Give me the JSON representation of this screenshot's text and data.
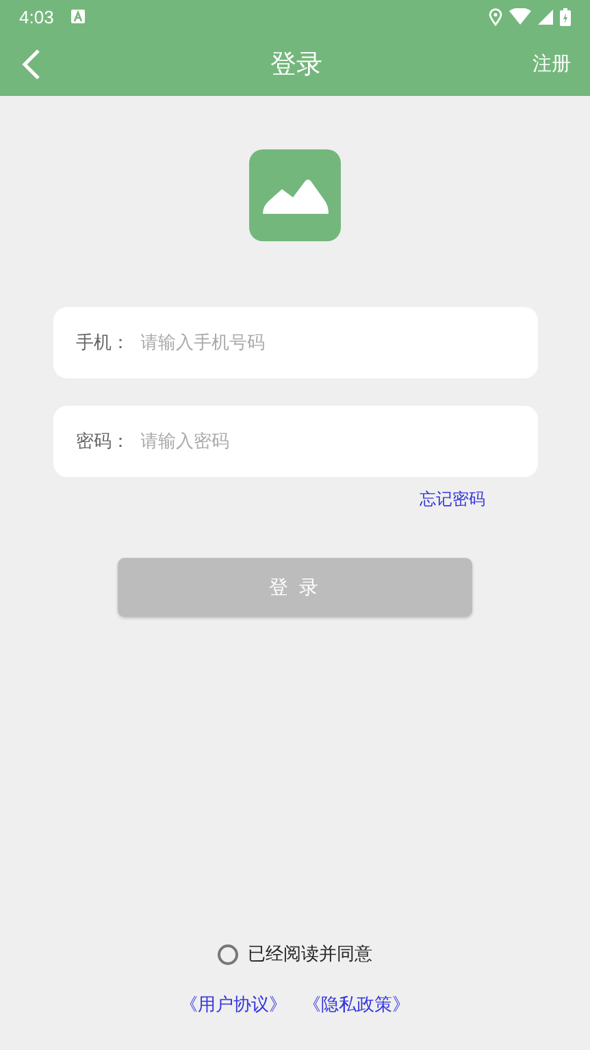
{
  "status_bar": {
    "time": "4:03"
  },
  "toolbar": {
    "title": "登录",
    "action": "注册"
  },
  "fields": [
    {
      "label": "手机：",
      "placeholder": "请输入手机号码"
    },
    {
      "label": "密码：",
      "placeholder": "请输入密码"
    }
  ],
  "forgot_link": "忘记密码",
  "login_button": {
    "label": "登 录",
    "disabled": true
  },
  "agreement": {
    "label": "已经阅读并同意",
    "checked": false
  },
  "links": [
    "《用户协议》",
    "《隐私政策》"
  ]
}
